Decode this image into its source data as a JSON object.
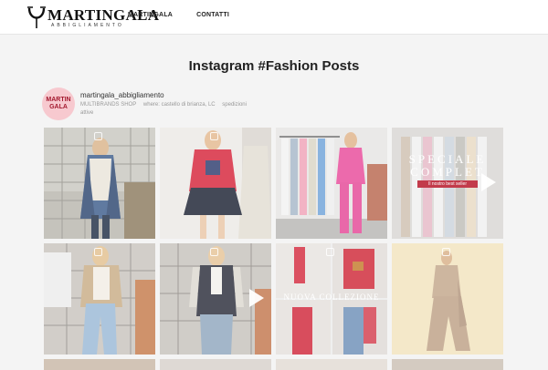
{
  "header": {
    "logo_text": "MARTINGALA",
    "logo_subtext": "ABBIGLIAMENTO",
    "nav": [
      "MARTINGALA",
      "CONTATTI"
    ]
  },
  "page_title": "Instagram #Fashion Posts",
  "profile": {
    "avatar_text_top": "MARTIN",
    "avatar_text_bottom": "GALA",
    "username": "martingala_abbigliamento",
    "bio_parts": [
      "MULTIBRANDS SHOP",
      "where: castello di brianza, LC",
      "spedizioni attive"
    ]
  },
  "posts": [
    {
      "type": "carousel"
    },
    {
      "type": "carousel"
    },
    {
      "type": "image"
    },
    {
      "type": "video",
      "overlay_title": "SPECIALE COMPLET",
      "overlay_tag": "Il nostro best seller"
    },
    {
      "type": "carousel"
    },
    {
      "type": "video"
    },
    {
      "type": "carousel",
      "overlay_title": "NUOVA COLLEZIONE"
    },
    {
      "type": "carousel"
    }
  ],
  "colors": {
    "background": "#f4f4f4",
    "header": "#ffffff",
    "accent_red": "#c23b4b",
    "avatar_pink": "#f7c9cf"
  }
}
